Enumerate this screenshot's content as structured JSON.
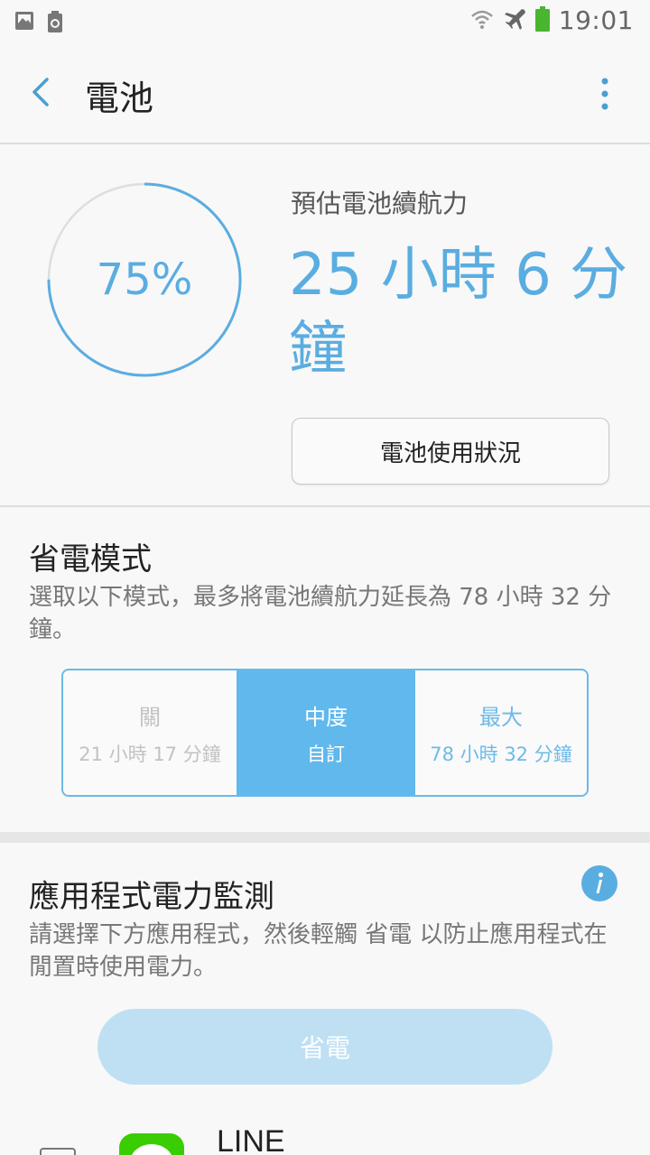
{
  "status_bar": {
    "time": "19:01",
    "icons": [
      "gallery-icon",
      "battery-saver-icon",
      "wifi-icon",
      "airplane-icon",
      "battery-icon"
    ]
  },
  "header": {
    "title": "電池"
  },
  "battery": {
    "percent_text": "75%",
    "level_fraction": 0.75,
    "estimate_label": "預估電池續航力",
    "estimate_value": "25 小時 6 分鐘",
    "usage_button_label": "電池使用狀況"
  },
  "power_saving": {
    "title": "省電模式",
    "description": "選取以下模式，最多將電池續航力延長為 78 小時 32 分鐘。",
    "modes": [
      {
        "name": "關",
        "detail": "21 小時 17 分鐘"
      },
      {
        "name": "中度",
        "detail": "自訂"
      },
      {
        "name": "最大",
        "detail": "78 小時 32 分鐘"
      }
    ],
    "selected": "中度"
  },
  "app_monitor": {
    "title": "應用程式電力監測",
    "description": "請選擇下方應用程式，然後輕觸 省電 以防止應用程式在閒置時使用電力。",
    "save_button_label": "省電",
    "apps": [
      {
        "name": "LINE"
      }
    ]
  },
  "colors": {
    "accent": "#5aade0",
    "selected_segment": "#61b8ec",
    "disabled_button": "#bfe0f3",
    "line_brand": "#3acd01"
  }
}
